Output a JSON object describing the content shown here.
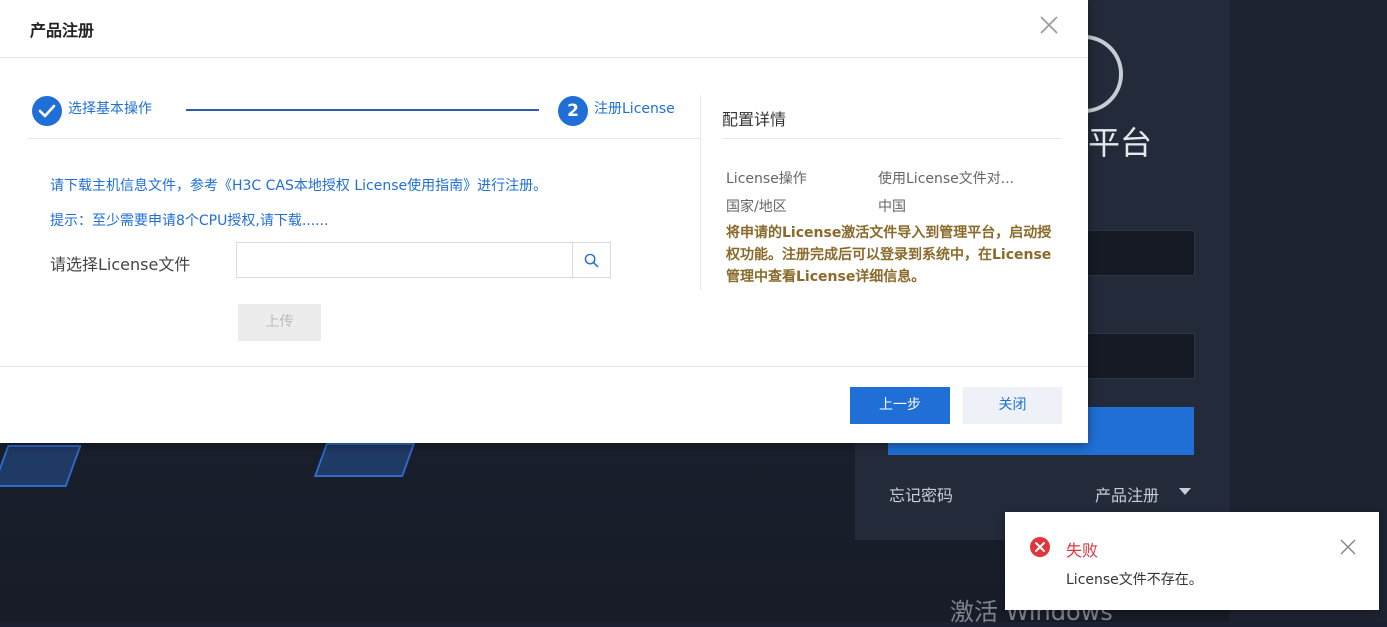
{
  "background": {
    "title": "平台",
    "forgot_password": "忘记密码",
    "product_register": "产品注册",
    "watermark": "激活 Windows"
  },
  "modal": {
    "title": "产品注册",
    "steps": [
      {
        "label": "选择基本操作",
        "state": "done"
      },
      {
        "number": "2",
        "label": "注册License",
        "state": "active"
      }
    ],
    "hint_download": "请下载主机信息文件，参考《H3C CAS本地授权 License使用指南》进行注册。",
    "hint_cpu": "提示：至少需要申请8个CPU授权,请下载......",
    "file_label": "请选择License文件",
    "file_value": "",
    "upload_label": "上传",
    "details": {
      "title": "配置详情",
      "rows": [
        {
          "key": "License操作",
          "value": "使用License文件对..."
        },
        {
          "key": "国家/地区",
          "value": "中国"
        }
      ],
      "note": "将申请的License激活文件导入到管理平台，启动授权功能。注册完成后可以登录到系统中，在License管理中查看License详细信息。"
    },
    "prev_label": "上一步",
    "close_label": "关闭"
  },
  "notification": {
    "title": "失败",
    "message": "License文件不存在。"
  },
  "colors": {
    "primary": "#1f6fd6",
    "error": "#e0353d",
    "note": "#8a6a2a"
  }
}
